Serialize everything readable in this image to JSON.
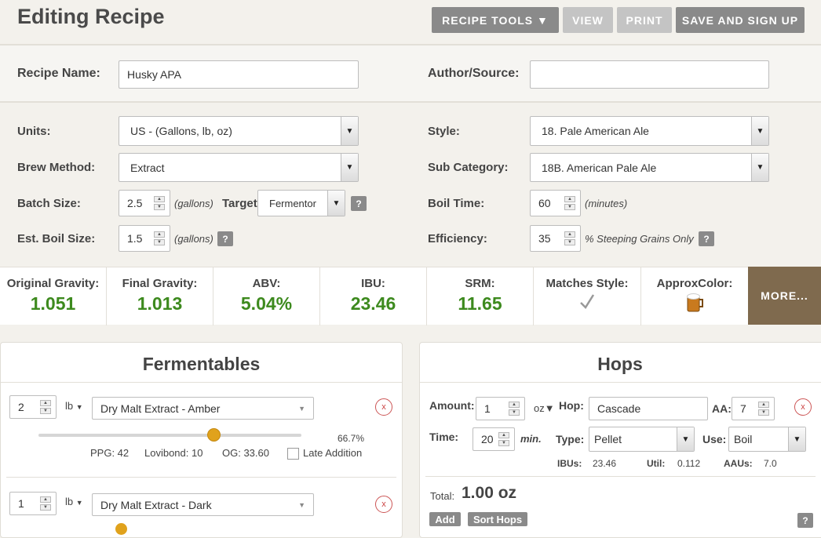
{
  "header": {
    "title": "Editing Recipe",
    "recipe_tools": "RECIPE TOOLS ▼",
    "view": "VIEW",
    "print": "PRINT",
    "save": "SAVE AND SIGN UP"
  },
  "recipe": {
    "name_label": "Recipe Name:",
    "name_value": "Husky APA",
    "author_label": "Author/Source:",
    "author_value": ""
  },
  "settings": {
    "units_label": "Units:",
    "units_value": "US - (Gallons, lb, oz)",
    "brew_label": "Brew Method:",
    "brew_value": "Extract",
    "batch_label": "Batch Size:",
    "batch_value": "2.5",
    "batch_unit": "(gallons)",
    "target_label": "Target:",
    "target_value": "Fermentor",
    "boil_size_label": "Est. Boil Size:",
    "boil_size_value": "1.5",
    "boil_size_unit": "(gallons)",
    "style_label": "Style:",
    "style_value": "18. Pale American Ale",
    "subcat_label": "Sub Category:",
    "subcat_value": "18B. American Pale Ale",
    "boil_time_label": "Boil Time:",
    "boil_time_value": "60",
    "boil_time_unit": "(minutes)",
    "eff_label": "Efficiency:",
    "eff_value": "35",
    "eff_unit": "% Steeping Grains Only",
    "help": "?"
  },
  "stats": {
    "og_label": "Original Gravity:",
    "og_value": "1.051",
    "fg_label": "Final Gravity:",
    "fg_value": "1.013",
    "abv_label": "ABV:",
    "abv_value": "5.04%",
    "ibu_label": "IBU:",
    "ibu_value": "23.46",
    "srm_label": "SRM:",
    "srm_value": "11.65",
    "match_label": "Matches Style:",
    "color_label": "ApproxColor:",
    "more": "MORE...",
    "beer_color": "#c97a1e"
  },
  "fermentables": {
    "title": "Fermentables",
    "items": [
      {
        "amount": "2",
        "unit": "lb",
        "name": "Dry Malt Extract - Amber",
        "percent": "66.7%",
        "slider_fraction": 0.667,
        "ppg": "PPG: 42",
        "lovibond": "Lovibond: 10",
        "og": "OG: 33.60",
        "late": "Late Addition",
        "remove": "x"
      },
      {
        "amount": "1",
        "unit": "lb",
        "name": "Dry Malt Extract - Dark",
        "remove": "x"
      }
    ]
  },
  "hops": {
    "title": "Hops",
    "amount_label": "Amount:",
    "amount_value": "1",
    "amount_unit": "oz▼",
    "hop_label": "Hop:",
    "hop_value": "Cascade",
    "aa_label": "AA:",
    "aa_value": "7",
    "time_label": "Time:",
    "time_value": "20",
    "time_unit": "min.",
    "type_label": "Type:",
    "type_value": "Pellet",
    "use_label": "Use:",
    "use_value": "Boil",
    "ibus_label": "IBUs:",
    "ibus_value": "23.46",
    "util_label": "Util:",
    "util_value": "0.112",
    "aaus_label": "AAUs:",
    "aaus_value": "7.0",
    "total_label": "Total:",
    "total_value": "1.00 oz",
    "add": "Add",
    "sort": "Sort Hops",
    "help": "?",
    "remove": "x"
  }
}
